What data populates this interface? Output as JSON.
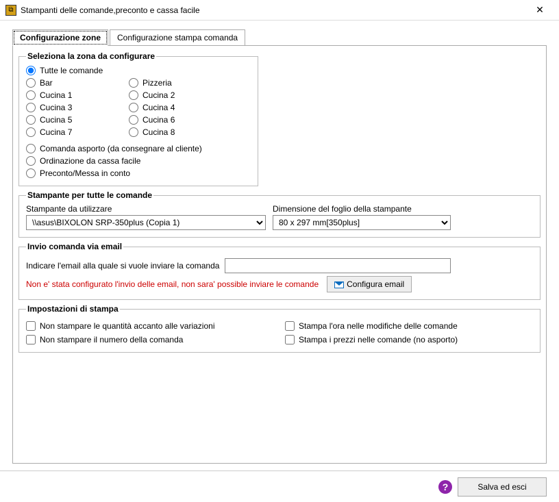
{
  "window": {
    "title": "Stampanti delle comande,preconto e cassa facile"
  },
  "tabs": {
    "zone": "Configurazione zone",
    "stampa": "Configurazione stampa comanda"
  },
  "zone": {
    "legend": "Seleziona la zona da configurare",
    "all": "Tutte le comande",
    "bar": "Bar",
    "pizzeria": "Pizzeria",
    "cucina1": "Cucina 1",
    "cucina2": "Cucina 2",
    "cucina3": "Cucina 3",
    "cucina4": "Cucina 4",
    "cucina5": "Cucina 5",
    "cucina6": "Cucina 6",
    "cucina7": "Cucina 7",
    "cucina8": "Cucina 8",
    "asporto": "Comanda asporto (da consegnare al cliente)",
    "cassa": "Ordinazione da cassa facile",
    "preconto": "Preconto/Messa in conto"
  },
  "printer": {
    "heading": "Stampante per tutte le comande",
    "uselabel": "Stampante da utilizzare",
    "selected": "\\\\asus\\BIXOLON SRP-350plus (Copia 1)",
    "dimlabel": "Dimensione del foglio della stampante",
    "dimselected": "80 x 297 mm[350plus]"
  },
  "email": {
    "heading": "Invio comanda via email",
    "label": "Indicare l'email alla quale si vuole inviare la comanda",
    "warning": "Non e' stata configurato l'invio delle email, non sara' possible inviare le comande",
    "btn": "Configura email"
  },
  "settings": {
    "heading": "Impostazioni di stampa",
    "noqty": "Non stampare le quantità accanto alle variazioni",
    "ora": "Stampa l'ora nelle modifiche delle comande",
    "nonum": "Non stampare il numero della comanda",
    "prezzi": "Stampa i prezzi nelle comande (no asporto)"
  },
  "footer": {
    "save": "Salva ed esci"
  }
}
